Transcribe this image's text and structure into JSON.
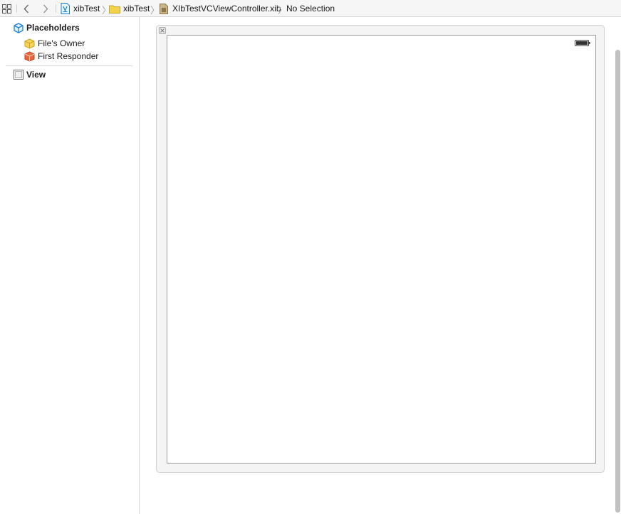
{
  "jumpbar": {
    "breadcrumbs": [
      {
        "label": "xibTest",
        "icon": "project-icon"
      },
      {
        "label": "xibTest",
        "icon": "folder-icon"
      },
      {
        "label": "XIbTestVCViewController.xib",
        "icon": "xib-file-icon"
      },
      {
        "label": "No Selection",
        "icon": ""
      }
    ]
  },
  "outline": {
    "placeholders_label": "Placeholders",
    "items": [
      {
        "label": "File's Owner",
        "icon": "files-owner-icon"
      },
      {
        "label": "First Responder",
        "icon": "first-responder-icon"
      }
    ],
    "view_label": "View"
  },
  "colors": {
    "accent": "#1a7fd4",
    "files_owner": "#f2c230",
    "first_responder": "#e0572c"
  }
}
